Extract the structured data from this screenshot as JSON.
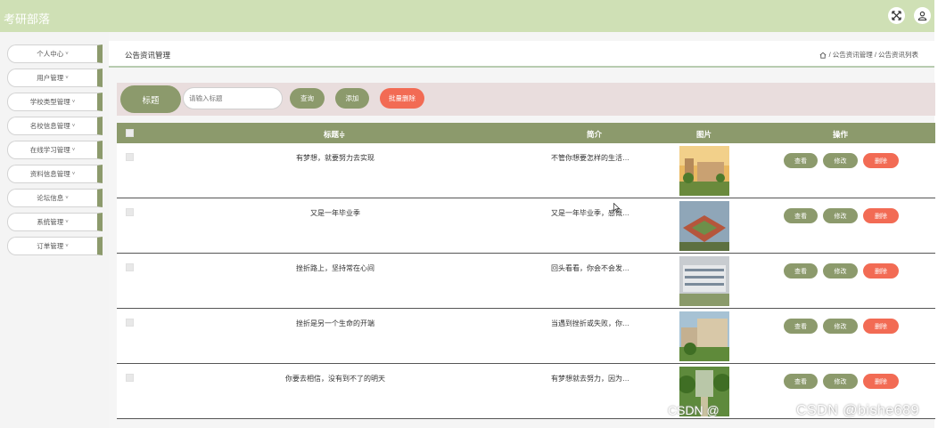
{
  "header": {
    "brand": "考研部落",
    "fullscreen_icon": "fullscreen-icon",
    "user_icon": "user-icon"
  },
  "sidebar": {
    "items": [
      {
        "label": "个人中心"
      },
      {
        "label": "用户管理"
      },
      {
        "label": "学校类型管理"
      },
      {
        "label": "名校信息管理"
      },
      {
        "label": "在线学习管理"
      },
      {
        "label": "资料信息管理"
      },
      {
        "label": "论坛信息"
      },
      {
        "label": "系统管理"
      },
      {
        "label": "订单管理"
      }
    ],
    "chevron": "˅"
  },
  "page": {
    "title": "公告资讯管理",
    "breadcrumb": "/ 公告资讯管理 / 公告资讯列表",
    "home_icon": "home-icon"
  },
  "search": {
    "field_label": "标题",
    "placeholder": "请输入标题",
    "query_label": "查询",
    "add_label": "添加",
    "batch_delete_label": "批量删除"
  },
  "table": {
    "columns": {
      "title": "标题≑",
      "intro": "简介",
      "image": "图片",
      "actions": "操作"
    },
    "rows": [
      {
        "title": "有梦想，就要努力去实现",
        "intro": "不管你想要怎样的生活…"
      },
      {
        "title": "又是一年毕业季",
        "intro": "又是一年毕业季，感慨…"
      },
      {
        "title": "挫折路上，坚持常在心间",
        "intro": "回头看看，你会不会发…"
      },
      {
        "title": "挫折是另一个生命的开端",
        "intro": "当遇到挫折或失败，你…"
      },
      {
        "title": "你要去相信，没有到不了的明天",
        "intro": "有梦想就去努力，因为…"
      }
    ],
    "actions": {
      "view": "查看",
      "edit": "修改",
      "delete": "删除"
    }
  },
  "watermark": {
    "left": "CSDN @",
    "right": "CSDN @bishe689"
  },
  "colors": {
    "accent": "#8c9a6c",
    "danger": "#f26b54",
    "topbar": "#cfe0b5",
    "search_bg": "#e9dddd"
  }
}
